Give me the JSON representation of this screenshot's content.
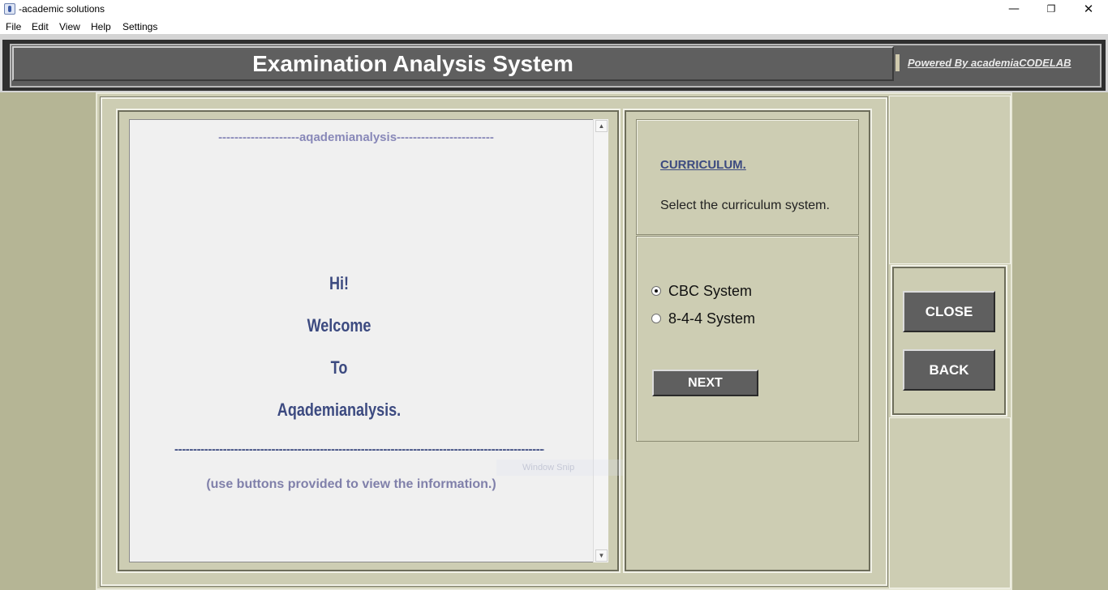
{
  "window": {
    "title": "-academic solutions",
    "controls": {
      "minimize": "—",
      "maximize": "❐",
      "close": "✕"
    }
  },
  "menu": [
    "File",
    "Edit",
    "View",
    "Help",
    "Settings"
  ],
  "header": {
    "title": "Examination Analysis System",
    "powered_by": "Powered By academiaCODELAB"
  },
  "welcome": {
    "dash_top": "--------------------aqademianalysis------------------------",
    "lines": [
      "Hi!",
      "Welcome",
      "To",
      "Aqademianalysis."
    ],
    "dash_bottom": "----------------------------------------------------------------------------------------------------",
    "instruction": "(use buttons provided to view the information.)"
  },
  "ghost_overlay": "Window Snip",
  "curriculum": {
    "heading": "CURRICULUM.",
    "description": "Select the curriculum system.",
    "options": [
      {
        "label": "CBC System",
        "selected": true
      },
      {
        "label": "8-4-4 System",
        "selected": false
      }
    ],
    "next_label": "NEXT"
  },
  "actions": {
    "close_label": "CLOSE",
    "back_label": "BACK"
  },
  "colors": {
    "background": "#b5b595",
    "panel": "#cdcdb3",
    "button": "#5f5f5f",
    "heading_text": "#3c4a80",
    "muted_text": "#8080aa"
  }
}
